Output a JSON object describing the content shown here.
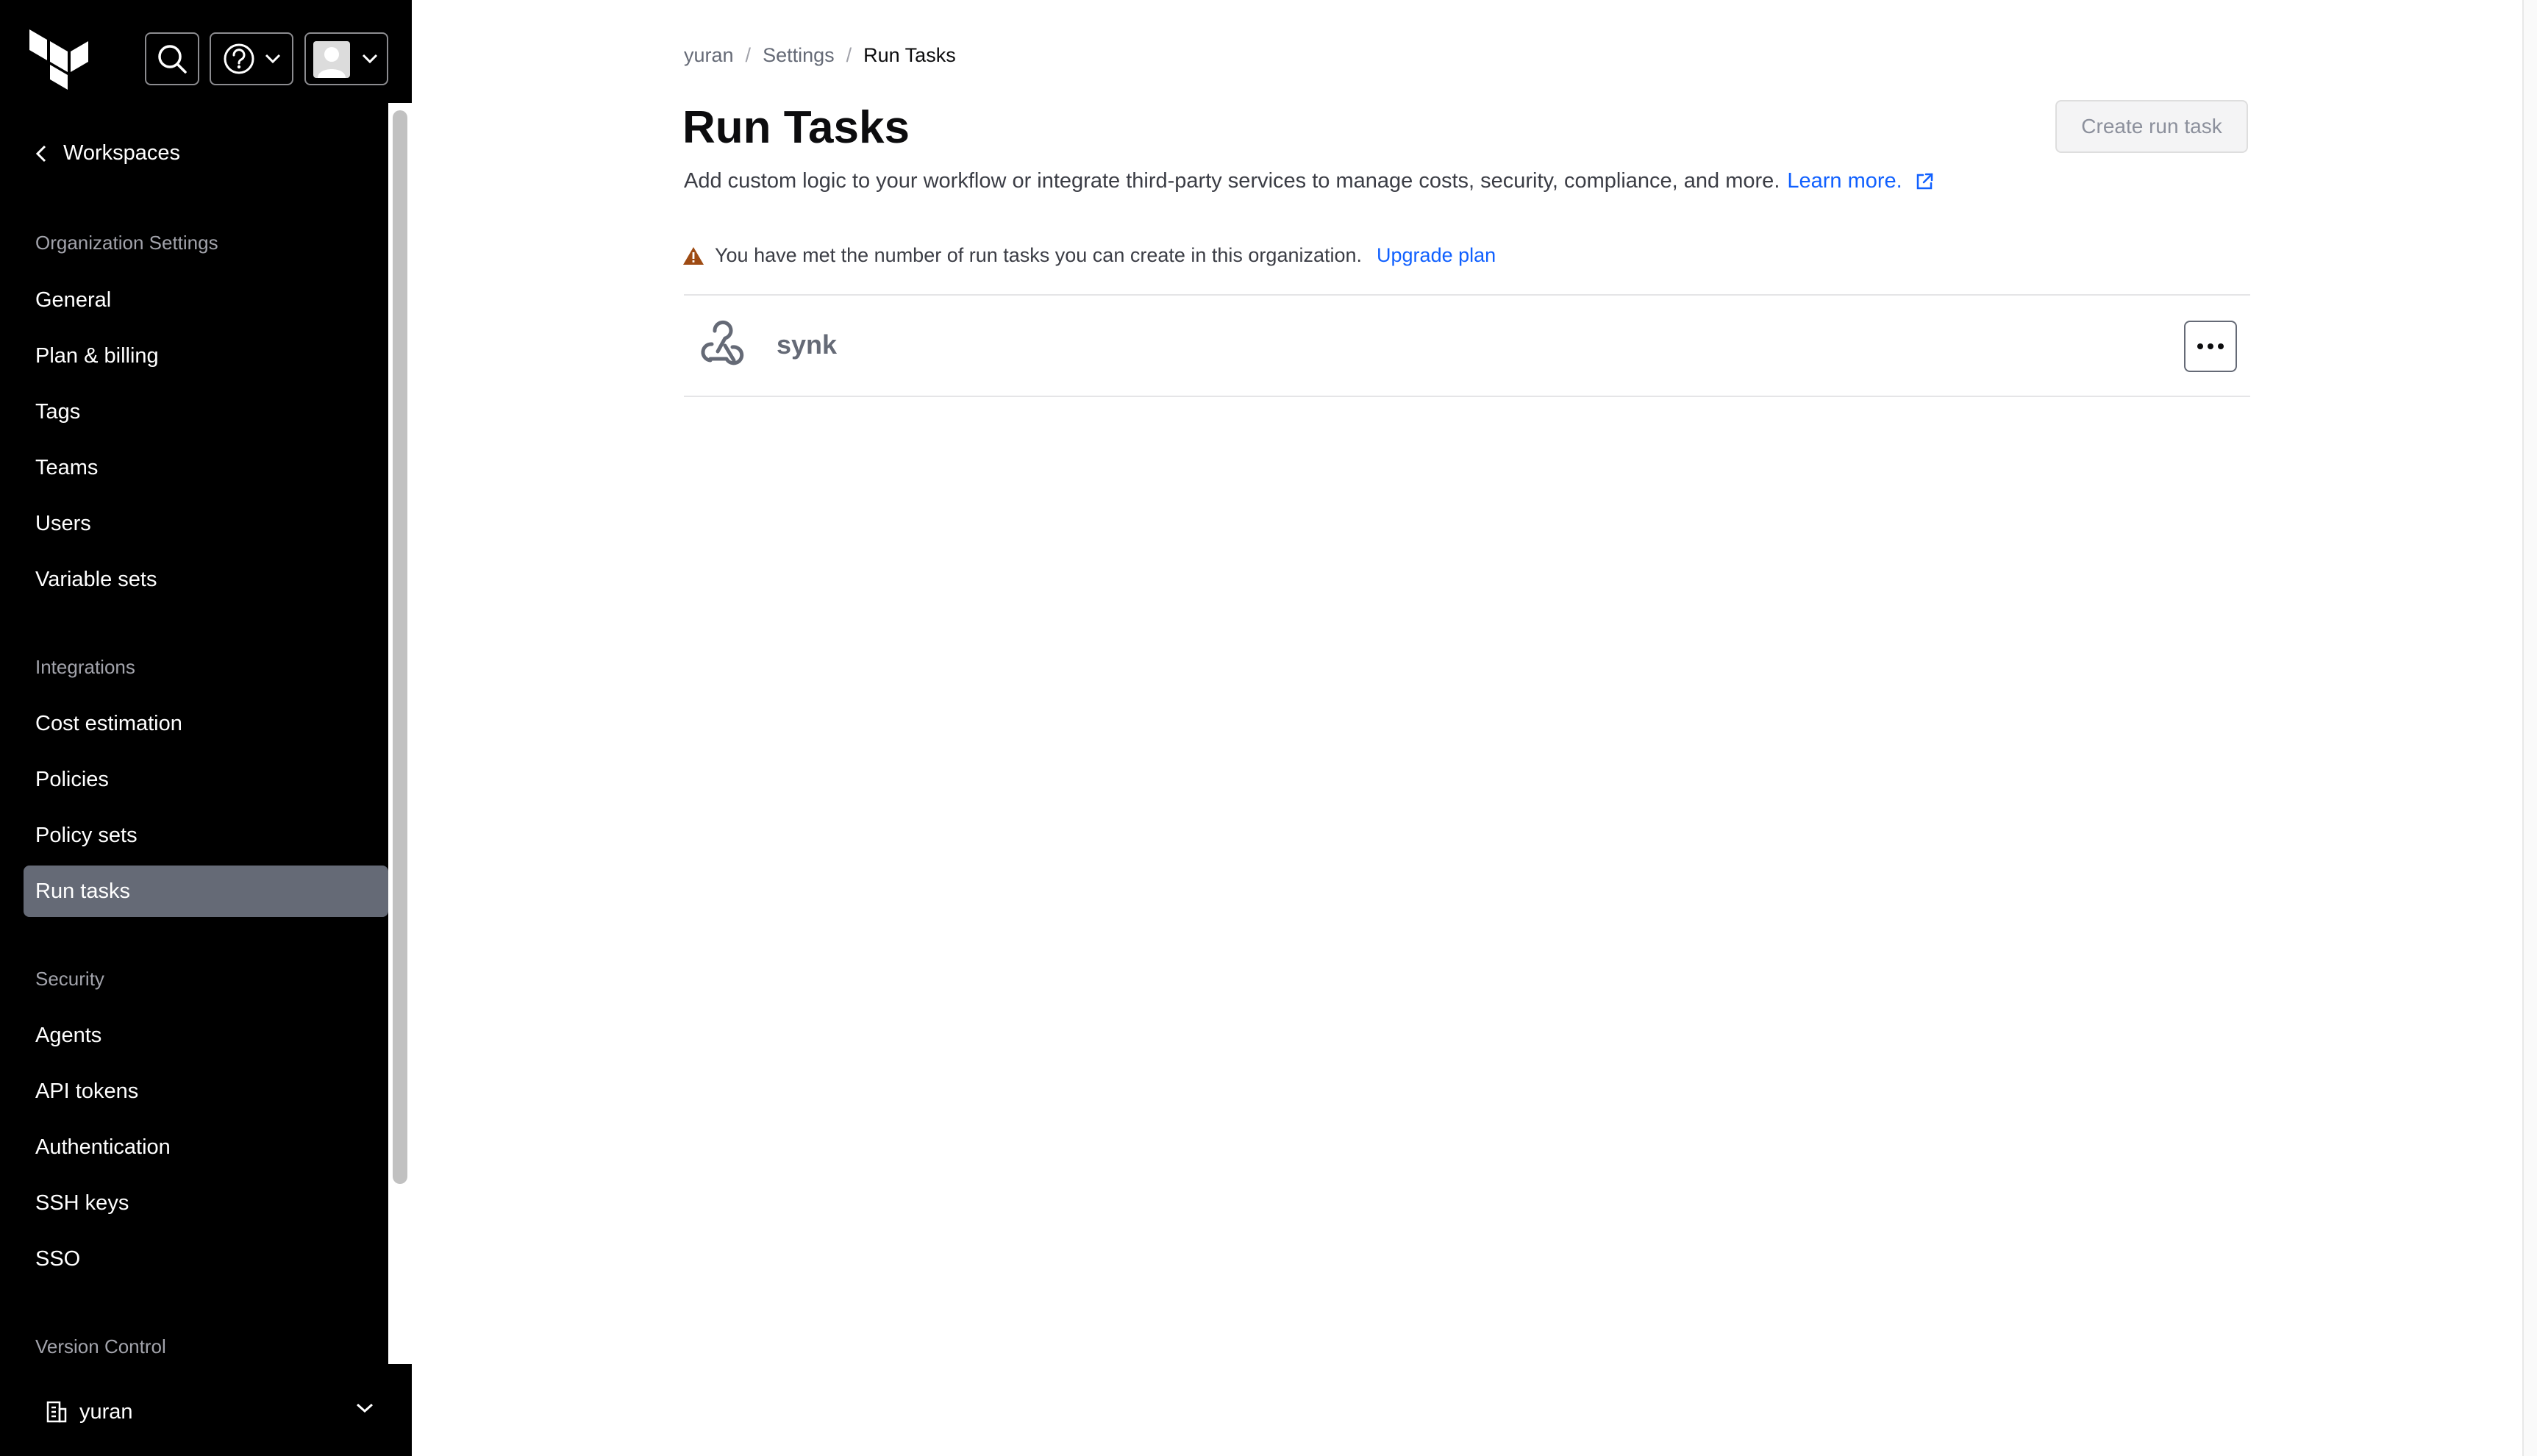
{
  "sidebar": {
    "back_label": "Workspaces",
    "sections": [
      {
        "label": "Organization Settings",
        "items": [
          "General",
          "Plan & billing",
          "Tags",
          "Teams",
          "Users",
          "Variable sets"
        ]
      },
      {
        "label": "Integrations",
        "items": [
          "Cost estimation",
          "Policies",
          "Policy sets",
          "Run tasks"
        ]
      },
      {
        "label": "Security",
        "items": [
          "Agents",
          "API tokens",
          "Authentication",
          "SSH keys",
          "SSO"
        ]
      },
      {
        "label": "Version Control",
        "items": []
      }
    ],
    "active_item": "Run tasks",
    "org_name": "yuran"
  },
  "breadcrumb": {
    "org": "yuran",
    "settings": "Settings",
    "current": "Run Tasks",
    "separator": "/"
  },
  "page": {
    "title": "Run Tasks",
    "description": "Add custom logic to your workflow or integrate third-party services to manage costs, security, compliance, and more.",
    "learn_more": "Learn more.",
    "create_button": "Create run task"
  },
  "alert": {
    "text": "You have met the number of run tasks you can create in this organization.",
    "link": "Upgrade plan",
    "icon": "warning-triangle-icon",
    "color": "#9e4b13"
  },
  "tasks": [
    {
      "name": "synk",
      "icon": "webhook-icon"
    }
  ],
  "colors": {
    "sidebar_bg": "#000000",
    "active_item_bg": "#656a76",
    "link": "#1060ff"
  }
}
